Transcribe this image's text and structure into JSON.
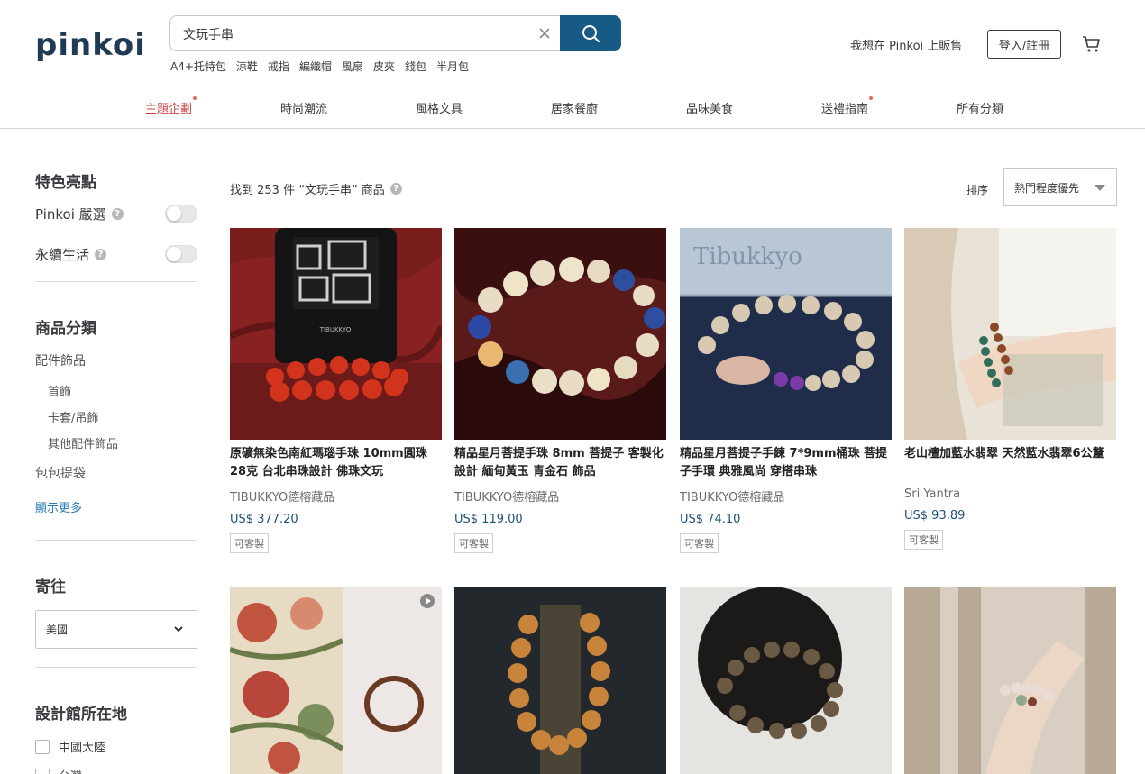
{
  "header": {
    "logo": "pinkoi",
    "search": {
      "value": "文玩手串",
      "placeholder": ""
    },
    "hot_keywords": [
      "A4+托特包",
      "涼鞋",
      "戒指",
      "編織帽",
      "風扇",
      "皮夾",
      "錢包",
      "半月包"
    ],
    "sell_link": "我想在 Pinkoi 上販售",
    "login_label": "登入/註冊"
  },
  "nav": [
    {
      "label": "主題企劃",
      "active": true,
      "dot": true
    },
    {
      "label": "時尚潮流",
      "active": false,
      "dot": false
    },
    {
      "label": "風格文具",
      "active": false,
      "dot": false
    },
    {
      "label": "居家餐廚",
      "active": false,
      "dot": false
    },
    {
      "label": "品味美食",
      "active": false,
      "dot": false
    },
    {
      "label": "送禮指南",
      "active": false,
      "dot": true
    },
    {
      "label": "所有分類",
      "active": false,
      "dot": false
    }
  ],
  "sidebar": {
    "features_title": "特色亮點",
    "toggles": [
      {
        "label": "Pinkoi 嚴選",
        "on": false
      },
      {
        "label": "永續生活",
        "on": false
      }
    ],
    "category_title": "商品分類",
    "categories": [
      {
        "label": "配件飾品",
        "children": [
          "首飾",
          "卡套/吊飾",
          "其他配件飾品"
        ]
      },
      {
        "label": "包包提袋",
        "children": []
      }
    ],
    "show_more": "顯示更多",
    "ship_title": "寄往",
    "ship_value": "美國",
    "location_title": "設計館所在地",
    "locations": [
      "中國大陸",
      "台灣"
    ]
  },
  "results": {
    "count_text": "找到 253 件 “文玩手串” 商品",
    "sort_label": "排序",
    "sort_value": "熱門程度優先"
  },
  "products": [
    {
      "title": "原礦無染色南紅瑪瑙手珠 10mm圓珠28克 台北串珠設計 佛珠文玩",
      "shop": "TIBUKKYO德榕藏品",
      "price": "US$ 377.20",
      "badge": "可客製"
    },
    {
      "title": "精品星月菩提手珠 8mm 菩提子 客製化設計 緬甸黃玉 青金石 飾品",
      "shop": "TIBUKKYO德榕藏品",
      "price": "US$ 119.00",
      "badge": "可客製"
    },
    {
      "title": "精品星月菩提子手鍊 7*9mm桶珠 菩提子手環 典雅風尚 穿搭串珠",
      "shop": "TIBUKKYO德榕藏品",
      "price": "US$ 74.10",
      "badge": "可客製"
    },
    {
      "title": "老山檀加藍水翡翠 天然藍水翡翠6公釐",
      "shop": "Sri Yantra",
      "price": "US$ 93.89",
      "badge": "可客製"
    }
  ],
  "image_texts": {
    "tibukkyo_box": "TIBUKKYO",
    "tibukkyo_banner": "Tibukkyo"
  }
}
